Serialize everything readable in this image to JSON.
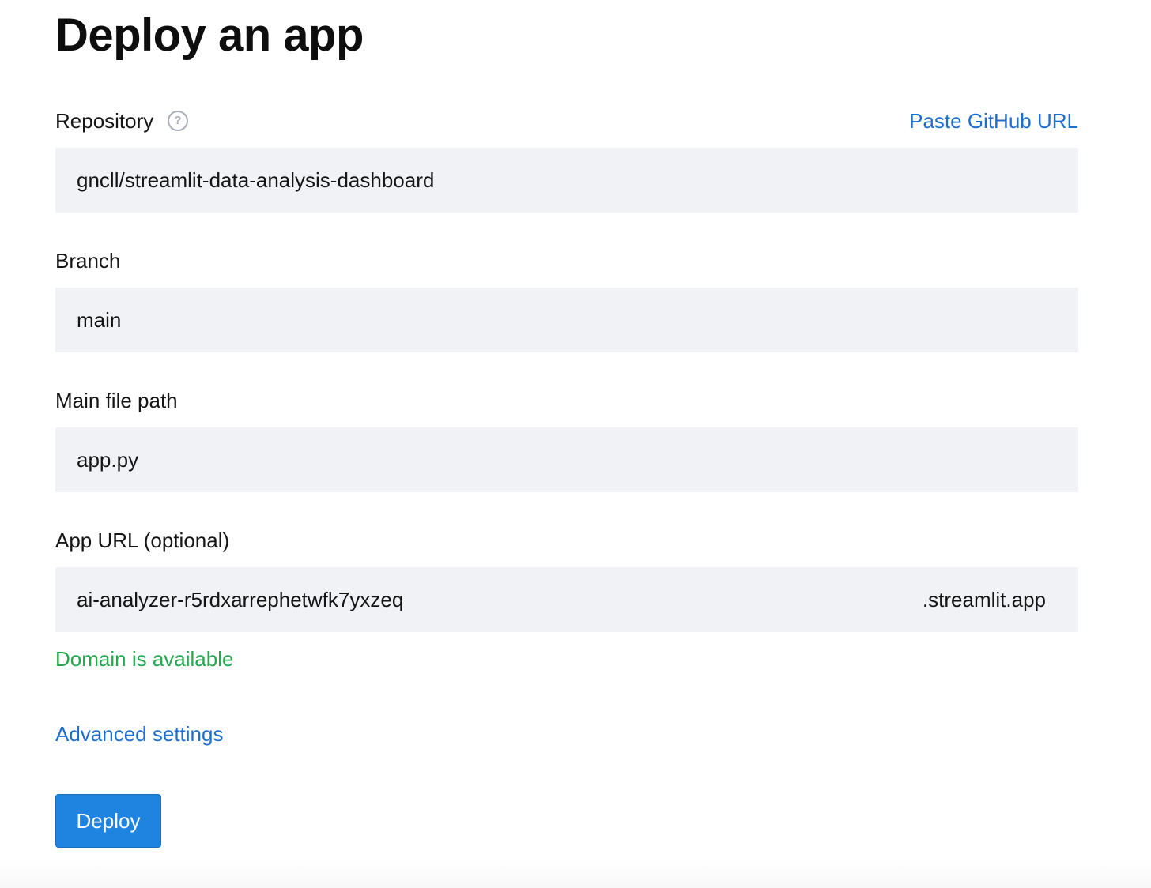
{
  "page": {
    "title": "Deploy an app"
  },
  "repository": {
    "label": "Repository",
    "help_icon_glyph": "?",
    "help_icon": "question-circle-icon",
    "paste_link": "Paste GitHub URL",
    "value": "gncll/streamlit-data-analysis-dashboard"
  },
  "branch": {
    "label": "Branch",
    "value": "main"
  },
  "main_file": {
    "label": "Main file path",
    "value": "app.py"
  },
  "app_url": {
    "label": "App URL (optional)",
    "value": "ai-analyzer-r5rdxarrephetwfk7yxzeq",
    "suffix": ".streamlit.app",
    "status": "Domain is available"
  },
  "advanced_settings": {
    "label": "Advanced settings"
  },
  "deploy": {
    "label": "Deploy"
  },
  "colors": {
    "link": "#1c6fd1",
    "success": "#21a94b",
    "input_bg": "#f0f2f6",
    "button_bg": "#1f84e0"
  }
}
